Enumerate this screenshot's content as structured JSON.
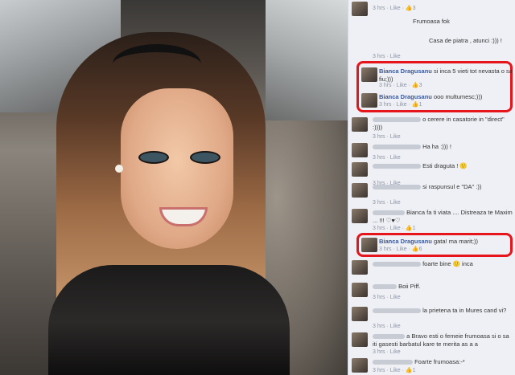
{
  "comments": [
    {
      "text": "",
      "meta": "3 hrs · Like · ",
      "likes": "3"
    },
    {
      "text": "Frumoasa fok",
      "meta": ""
    },
    {
      "text": "Casa de piatra , atunci :))) !",
      "meta": "3 hrs · Like"
    },
    {
      "name": "Bianca Dragusanu",
      "text": "si inca 5 vieti tot nevasta o sa fiu;)))",
      "meta": "3 hrs · Like · ",
      "likes": "3"
    },
    {
      "name": "Bianca Dragusanu",
      "text": "ooo multumesc;)))",
      "meta": "3 hrs · Like · ",
      "likes": "1"
    },
    {
      "text": "o cerere in casatorie in \"direct\" :))))",
      "meta": "3 hrs · Like"
    },
    {
      "text": "Ha ha :))) !",
      "meta": "3 hrs · Like"
    },
    {
      "text": "Esti draguta ! 🙂",
      "meta": "3 hrs · Like"
    },
    {
      "text": "si raspunsul e \"DA\" :))",
      "meta": "3 hrs · Like"
    },
    {
      "text": "Bianca fa ti viata .... Distreaza te Maxim ... !!! ♡♥♡",
      "meta": "3 hrs · Like · ",
      "likes": "1"
    },
    {
      "name": "Bianca Dragusanu",
      "text": "gata! ma marit;))",
      "meta": "3 hrs · Like · ",
      "likes": "6"
    },
    {
      "text": "foarte bine 🙂 inca",
      "meta": ""
    },
    {
      "text": "Boii Piff.",
      "meta": "3 hrs · Like"
    },
    {
      "text": "la prietena ta in Mures cand vi?",
      "meta": "3 hrs · Like"
    },
    {
      "text": "a Bravo esti o femeie frumoasa si o sa iti gasesti barbatul kare te merita as a a",
      "meta": "3 hrs · Like"
    },
    {
      "text": "Foarte frumoasa:-*",
      "meta": "3 hrs · Like · ",
      "likes": "1"
    }
  ],
  "colors": {
    "link": "#3b5998",
    "highlight": "#e6141b",
    "panel": "#eef0f5"
  }
}
